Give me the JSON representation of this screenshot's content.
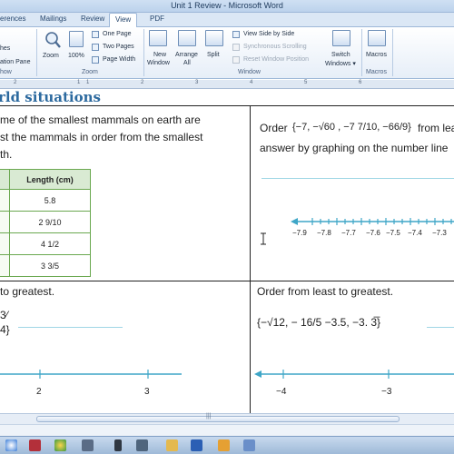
{
  "window": {
    "title": "Unit 1 Review  -  Microsoft Word"
  },
  "tabs": {
    "references": "erences",
    "mailings": "Mailings",
    "review": "Review",
    "view": "View",
    "pdf": "PDF"
  },
  "ribbon": {
    "left_group": {
      "line1": "hes",
      "line2": "ation Pane",
      "label": "how"
    },
    "zoom_group": {
      "zoom": "Zoom",
      "hundred": "100%",
      "one_page": "One Page",
      "two_pages": "Two Pages",
      "page_width": "Page Width",
      "label": "Zoom"
    },
    "window_group": {
      "new_window_1": "New",
      "new_window_2": "Window",
      "arrange_1": "Arrange",
      "arrange_2": "All",
      "split": "Split",
      "side_by_side": "View Side by Side",
      "sync_scroll": "Synchronous Scrolling",
      "reset_pos": "Reset Window Position",
      "switch_1": "Switch",
      "switch_2": "Windows ▾",
      "label": "Window"
    },
    "macros_group": {
      "macros": "Macros",
      "label": "Macros"
    }
  },
  "ruler": {
    "marks": [
      "2",
      "1",
      "1",
      "2",
      "3",
      "4",
      "5",
      "6"
    ]
  },
  "document": {
    "heading": "rld situations",
    "q1": {
      "line1": "me of the smallest mammals on earth are",
      "line2": "st the mammals in order from the smallest",
      "line3": "th.",
      "table_header": "Length (cm)",
      "rows": [
        "5.8",
        "2 9/10",
        "4 1/2",
        "3 3/5"
      ]
    },
    "q2": {
      "prefix": "Order",
      "set": "{−7, −√60 , −7 7/10, −66/9}",
      "suffix": "from lea",
      "line2": "answer by graphing on the number line",
      "axis_labels": [
        "−7.9",
        "−7.8",
        "−7.7",
        "−7.6",
        "−7.5",
        "−7.4",
        "−7.3"
      ]
    },
    "q3": {
      "line1": "to greatest.",
      "frac": "3⁄",
      "frac2": "4}",
      "axis_labels": [
        "2",
        "3"
      ]
    },
    "q4": {
      "line1": "Order from least to greatest.",
      "set": "{−√12, − 16/5 −3.5, −3. 3̅}",
      "axis_labels": [
        "−4",
        "−3"
      ]
    }
  },
  "colors": {
    "number_line": "#3ea6c7",
    "answer_line": "#9fd6e5",
    "table_border": "#6aa84f",
    "heading": "#2d6a9f"
  },
  "taskbar": {
    "icons": [
      "start-icon",
      "access-icon",
      "chrome-icon",
      "media-icon",
      "phone-icon",
      "network-icon",
      "folder-icon",
      "word-icon",
      "outlook-icon",
      "paint-icon"
    ]
  }
}
